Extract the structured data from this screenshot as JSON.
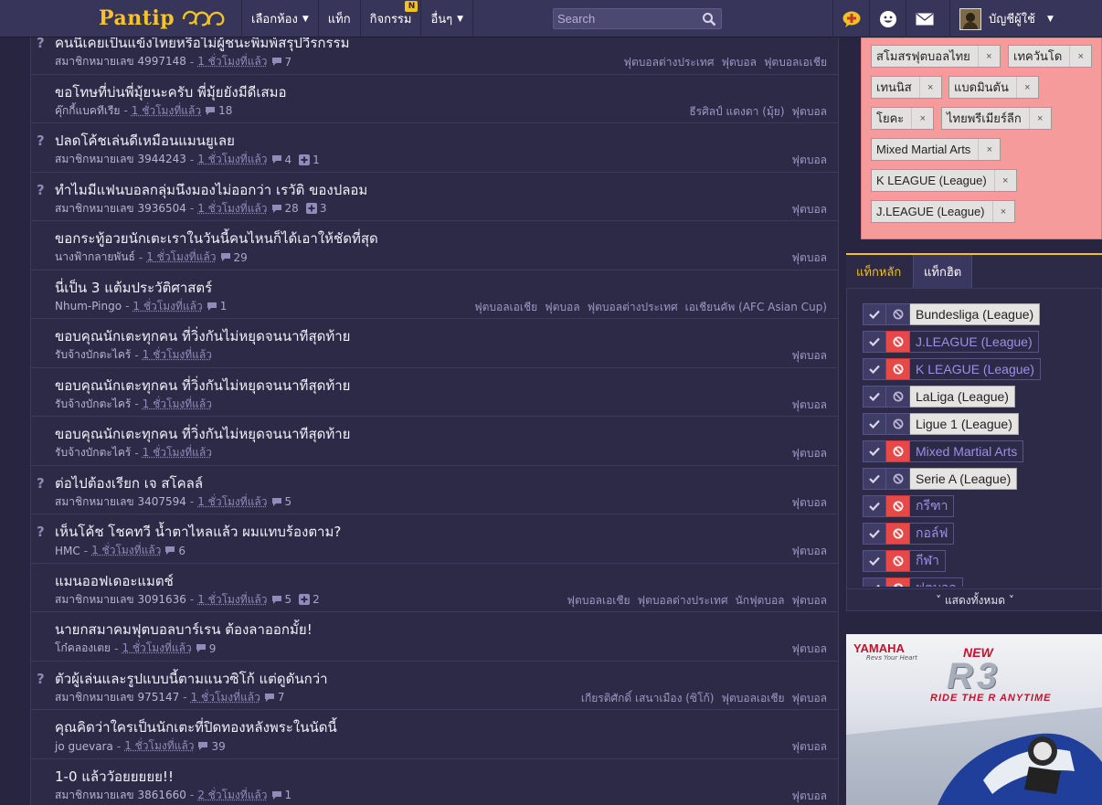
{
  "brand": {
    "logo_text": "Pantip"
  },
  "nav": {
    "items": [
      {
        "label": "เลือกห้อง",
        "caret": "▼"
      },
      {
        "label": "แท็ก",
        "caret": ""
      },
      {
        "label": "กิจกรรม",
        "caret": "",
        "badge": "N"
      },
      {
        "label": "อื่นๆ",
        "caret": "▼"
      }
    ]
  },
  "search": {
    "placeholder": "Search"
  },
  "user": {
    "name": "บัญชีผู้ใช้",
    "caret": "▼"
  },
  "icons": {
    "post": "create-post-icon",
    "emoji": "emoticon-icon",
    "mail": "mail-icon",
    "search": "search-icon"
  },
  "colors": {
    "accent": "#f0c224",
    "background": "#27253f",
    "favorite_box": "#f59b9b",
    "block_on": "#e94848",
    "link": "#9c8fe8"
  },
  "topics": [
    {
      "q": true,
      "title": "คนนี้เคยเป็นแข้งไทยหรือไม่ผู้ชนะพิมพ์สรุปวีรกรรม",
      "author": "สมาชิกหมายเลข 4997148",
      "time": "1 ชั่วโมงที่แล้ว",
      "comments": "7",
      "votes": "",
      "tags": [
        "ฟุตบอลต่างประเทศ",
        "ฟุตบอล",
        "ฟุตบอลเอเชีย"
      ]
    },
    {
      "q": false,
      "title": "ขอโทษที่บ่นพี่มุ้ยนะครับ พี่มุ้ยยังมีดีเสมอ",
      "author": "คุ๊กกี้แบคทีเรีย",
      "time": "1 ชั่วโมงที่แล้ว",
      "comments": "18",
      "votes": "",
      "tags": [
        "ธีรศิลป์ แดงดา (มุ้ย)",
        "ฟุตบอล"
      ]
    },
    {
      "q": true,
      "title": "ปลดโค้ชเล่นดีเหมือนแมนยูเลย",
      "author": "สมาชิกหมายเลข 3944243",
      "time": "1 ชั่วโมงที่แล้ว",
      "comments": "4",
      "votes": "1",
      "tags": [
        "ฟุตบอล"
      ]
    },
    {
      "q": true,
      "title": "ทำไมมีแฟนบอลกลุ่มนึงมองไม่ออกว่า เรวัติ ของปลอม",
      "author": "สมาชิกหมายเลข 3936504",
      "time": "1 ชั่วโมงที่แล้ว",
      "comments": "28",
      "votes": "3",
      "tags": [
        "ฟุตบอล"
      ]
    },
    {
      "q": false,
      "title": "ขอกระทู้อวยนักเตะเราในวันนี้คนไหนก็ได้เอาให้ชัดที่สุด",
      "author": "นางฟ้ากลายพันธ์",
      "time": "1 ชั่วโมงที่แล้ว",
      "comments": "29",
      "votes": "",
      "tags": [
        "ฟุตบอล"
      ]
    },
    {
      "q": false,
      "title": "นี่เป็น 3 แต้มประวัติศาสตร์",
      "author": "Nhum-Pingo",
      "time": "1 ชั่วโมงที่แล้ว",
      "comments": "1",
      "votes": "",
      "tags": [
        "ฟุตบอลเอเชีย",
        "ฟุตบอล",
        "ฟุตบอลต่างประเทศ",
        "เอเชียนคัพ (AFC Asian Cup)"
      ]
    },
    {
      "q": false,
      "title": "ขอบคุณนักเตะทุกคน ที่วิ่งกันไม่หยุดจนนาทีสุดท้าย",
      "author": "รับจ้างบักตะไคร้",
      "time": "1 ชั่วโมงที่แล้ว",
      "comments": "",
      "votes": "",
      "tags": [
        "ฟุตบอล"
      ]
    },
    {
      "q": false,
      "title": "ขอบคุณนักเตะทุกคน ที่วิ่งกันไม่หยุดจนนาทีสุดท้าย",
      "author": "รับจ้างบักตะไคร้",
      "time": "1 ชั่วโมงที่แล้ว",
      "comments": "",
      "votes": "",
      "tags": [
        "ฟุตบอล"
      ]
    },
    {
      "q": false,
      "title": "ขอบคุณนักเตะทุกคน ที่วิ่งกันไม่หยุดจนนาทีสุดท้าย",
      "author": "รับจ้างบักตะไคร้",
      "time": "1 ชั่วโมงที่แล้ว",
      "comments": "",
      "votes": "",
      "tags": [
        "ฟุตบอล"
      ]
    },
    {
      "q": true,
      "title": "ต่อไปต้องเรียก เจ สโคลล์",
      "author": "สมาชิกหมายเลข 3407594",
      "time": "1 ชั่วโมงที่แล้ว",
      "comments": "5",
      "votes": "",
      "tags": [
        "ฟุตบอล"
      ]
    },
    {
      "q": true,
      "title": "เห็นโค้ช โชคทวี น้ำตาไหลแล้ว ผมแทบร้องตาม?",
      "author": "HMC",
      "time": "1 ชั่วโมงที่แล้ว",
      "comments": "6",
      "votes": "",
      "tags": [
        "ฟุตบอล"
      ]
    },
    {
      "q": false,
      "title": "แมนออฟเดอะแมตช์",
      "author": "สมาชิกหมายเลข 3091636",
      "time": "1 ชั่วโมงที่แล้ว",
      "comments": "5",
      "votes": "2",
      "tags": [
        "ฟุตบอลเอเชีย",
        "ฟุตบอลต่างประเทศ",
        "นักฟุตบอล",
        "ฟุตบอล"
      ]
    },
    {
      "q": false,
      "title": "นายกสมาคมฟุตบอลบาร์เรน ต้องลาออกมั้ย!",
      "author": "โก๋คลองเตย",
      "time": "1 ชั่วโมงที่แล้ว",
      "comments": "9",
      "votes": "",
      "tags": [
        "ฟุตบอล"
      ]
    },
    {
      "q": true,
      "title": "ตัวผู้เล่นและรูปแบบนี้ตามแนวซิโก้ แต่ดูดันกว่า",
      "author": "สมาชิกหมายเลข 975147",
      "time": "1 ชั่วโมงที่แล้ว",
      "comments": "7",
      "votes": "",
      "tags": [
        "เกียรติศักดิ์ เสนาเมือง (ซิโก้)",
        "ฟุตบอลเอเชีย",
        "ฟุตบอล"
      ]
    },
    {
      "q": false,
      "title": "คุณคิดว่าใครเป็นนักเตะที่ปิดทองหลังพระในนัดนี้",
      "author": "jo guevara",
      "time": "1 ชั่วโมงที่แล้ว",
      "comments": "39",
      "votes": "",
      "tags": [
        "ฟุตบอล"
      ]
    },
    {
      "q": false,
      "title": "1-0 แล้ววัอยยยยย!!",
      "author": "สมาชิกหมายเลข 3861660",
      "time": "2 ชั่วโมงที่แล้ว",
      "comments": "1",
      "votes": "",
      "tags": [
        "ฟุตบอล"
      ]
    }
  ],
  "favorite_tags": [
    {
      "label": "สโมสรฟุตบอลไทย",
      "x_label": "×"
    },
    {
      "label": "เทควันโด",
      "x_label": "×"
    },
    {
      "label": "เทนนิส",
      "x_label": "×"
    },
    {
      "label": "แบดมินตัน",
      "x_label": "×"
    },
    {
      "label": "โยคะ",
      "x_label": "×"
    },
    {
      "label": "ไทยพรีเมียร์ลีก",
      "x_label": "×"
    },
    {
      "label": "Mixed Martial Arts",
      "x_label": "×"
    },
    {
      "label": "K LEAGUE (League)",
      "x_label": "×"
    },
    {
      "label": "J.LEAGUE (League)",
      "x_label": "×"
    }
  ],
  "tag_tabs": [
    {
      "label": "แท็กหลัก"
    },
    {
      "label": "แท็กฮิต"
    }
  ],
  "tag_list": [
    {
      "label": "Bundesliga (League)",
      "state": "follow"
    },
    {
      "label": "J.LEAGUE (League)",
      "state": "blocked"
    },
    {
      "label": "K LEAGUE (League)",
      "state": "blocked"
    },
    {
      "label": "LaLiga (League)",
      "state": "follow"
    },
    {
      "label": "Ligue 1 (League)",
      "state": "follow"
    },
    {
      "label": "Mixed Martial Arts",
      "state": "blocked"
    },
    {
      "label": "Serie A (League)",
      "state": "follow"
    },
    {
      "label": "กรีฑา",
      "state": "blocked"
    },
    {
      "label": "กอล์ฟ",
      "state": "blocked"
    },
    {
      "label": "กีฬา",
      "state": "blocked"
    },
    {
      "label": "ฟุตบอล",
      "state": "blocked"
    }
  ],
  "show_all": {
    "label": "˅ แสดงทั้งหมด ˅"
  },
  "ad": {
    "brand": "YAMAHA",
    "tagline": "Revs Your Heart",
    "new_label": "NEW",
    "model": "R3",
    "slogan": "RIDE THE R ANYTIME"
  }
}
